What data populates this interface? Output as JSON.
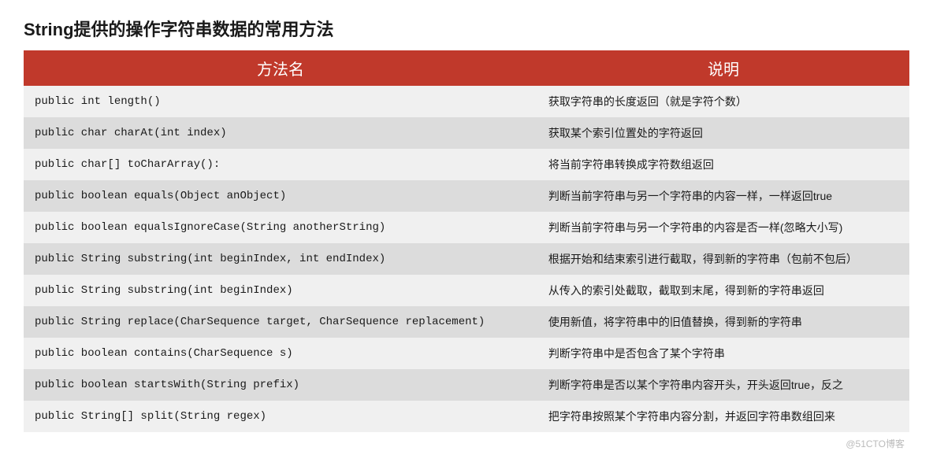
{
  "title": "String提供的操作字符串数据的常用方法",
  "headers": {
    "method": "方法名",
    "description": "说明"
  },
  "rows": [
    {
      "method": "public int length()",
      "desc": "获取字符串的长度返回（就是字符个数）"
    },
    {
      "method": "public char charAt(int index)",
      "desc": "获取某个索引位置处的字符返回"
    },
    {
      "method": "public char[] toCharArray():",
      "desc": "将当前字符串转换成字符数组返回"
    },
    {
      "method": "public boolean equals(Object anObject)",
      "desc": "判断当前字符串与另一个字符串的内容一样，一样返回true"
    },
    {
      "method": "public boolean equalsIgnoreCase(String anotherString)",
      "desc": "判断当前字符串与另一个字符串的内容是否一样(忽略大小写)"
    },
    {
      "method": "public String substring(int beginIndex, int endIndex)",
      "desc": "根据开始和结束索引进行截取，得到新的字符串（包前不包后）"
    },
    {
      "method": "public String substring(int beginIndex)",
      "desc": "从传入的索引处截取，截取到末尾，得到新的字符串返回"
    },
    {
      "method": "public String replace(CharSequence target, CharSequence replacement)",
      "desc": "使用新值，将字符串中的旧值替换，得到新的字符串"
    },
    {
      "method": "public boolean contains(CharSequence s)",
      "desc": "判断字符串中是否包含了某个字符串"
    },
    {
      "method": "public boolean startsWith(String prefix)",
      "desc": "判断字符串是否以某个字符串内容开头，开头返回true，反之"
    },
    {
      "method": "public String[] split(String regex)",
      "desc": "把字符串按照某个字符串内容分割，并返回字符串数组回来"
    }
  ],
  "watermark": "@51CTO博客"
}
